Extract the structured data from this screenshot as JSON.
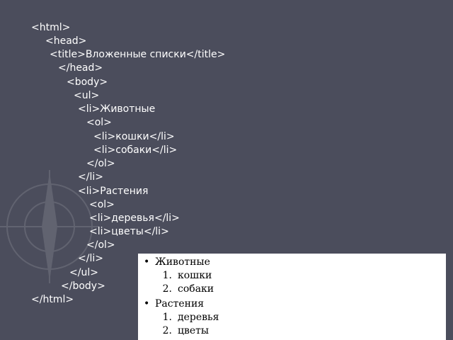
{
  "colors": {
    "slide_background": "#4b4d5c",
    "code_text": "#ffffff",
    "preview_background": "#ffffff",
    "preview_text": "#000000"
  },
  "code_lines": [
    "<html>",
    "<head>",
    "<title>Вложенные списки</title>",
    "</head>",
    "<body>",
    "<ul>",
    "<li>Животные",
    "<ol>",
    "<li>кошки</li>",
    "<li>собаки</li>",
    "</ol>",
    "</li>",
    "<li>Растения",
    "<ol>",
    "<li>деревья</li>",
    "<li>цветы</li>",
    "</ol>",
    "</li>",
    "</ul>",
    "</body>",
    "</html>"
  ],
  "preview": {
    "bullet_symbol": "•",
    "groups": [
      {
        "label": "Животные",
        "items": [
          {
            "number": "1.",
            "text": "кошки"
          },
          {
            "number": "2.",
            "text": "собаки"
          }
        ]
      },
      {
        "label": "Растения",
        "items": [
          {
            "number": "1.",
            "text": "деревья"
          },
          {
            "number": "2.",
            "text": "цветы"
          }
        ]
      }
    ]
  }
}
